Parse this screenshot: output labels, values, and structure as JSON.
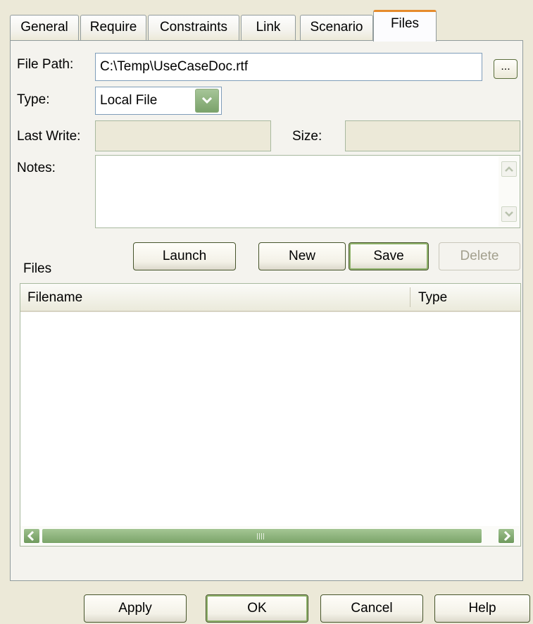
{
  "tabs": [
    "General",
    "Require",
    "Constraints",
    "Link",
    "Scenario",
    "Files"
  ],
  "fields": {
    "file_path_label": "File Path:",
    "file_path_value": "C:\\Temp\\UseCaseDoc.rtf",
    "browse_label": "...",
    "type_label": "Type:",
    "type_value": "Local File",
    "last_write_label": "Last Write:",
    "last_write_value": "",
    "size_label": "Size:",
    "size_value": "",
    "notes_label": "Notes:",
    "notes_value": ""
  },
  "file_buttons": {
    "launch": "Launch",
    "new": "New",
    "save": "Save",
    "delete": "Delete"
  },
  "files_section": {
    "label": "Files",
    "columns": [
      "Filename",
      "Type"
    ],
    "rows": []
  },
  "dialog_buttons": {
    "apply": "Apply",
    "ok": "OK",
    "cancel": "Cancel",
    "help": "Help"
  },
  "colors": {
    "active_tab_accent": "#e68b2c",
    "xp_olive_scroll": "#7aa26a",
    "dialog_bg": "#ece9d8"
  },
  "icons": {
    "dropdown": "chevron-down-icon",
    "scroll_left": "arrow-left-icon",
    "scroll_right": "arrow-right-icon",
    "scroll_up": "arrow-up-icon",
    "scroll_down": "arrow-down-icon"
  }
}
